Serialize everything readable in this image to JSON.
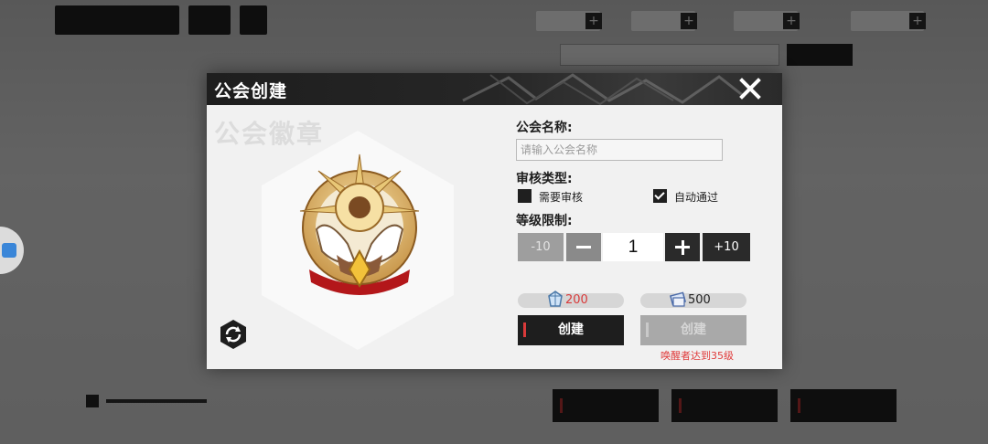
{
  "colors": {
    "accent_red": "#d93a3a",
    "dark_button": "#1e1e1e",
    "disabled_button": "#a9a9a9",
    "header_bg": "#1e1e1e"
  },
  "modal": {
    "title": "公会创建",
    "close_icon": "close-icon"
  },
  "emblem": {
    "watermark": "公会徽章",
    "icon": "guild-emblem-icon",
    "switch_icon": "switch-emblem-icon"
  },
  "form": {
    "name_label": "公会名称:",
    "name_placeholder": "请输入公会名称",
    "name_value": "",
    "review_label": "审核类型:",
    "review_options": [
      {
        "label": "需要审核",
        "checked": false
      },
      {
        "label": "自动通过",
        "checked": true
      }
    ],
    "level_label": "等级限制:",
    "stepper": {
      "minus10": "-10",
      "value": "1",
      "plus10": "+10"
    }
  },
  "costs": [
    {
      "icon": "crystal-icon",
      "amount": "200",
      "color": "#d93a3a"
    },
    {
      "icon": "ticket-icon",
      "amount": "500",
      "color": "#222222"
    }
  ],
  "buttons": {
    "create_primary": "创建",
    "create_secondary": "创建",
    "requirement_note": "唤醒者达到35级"
  }
}
